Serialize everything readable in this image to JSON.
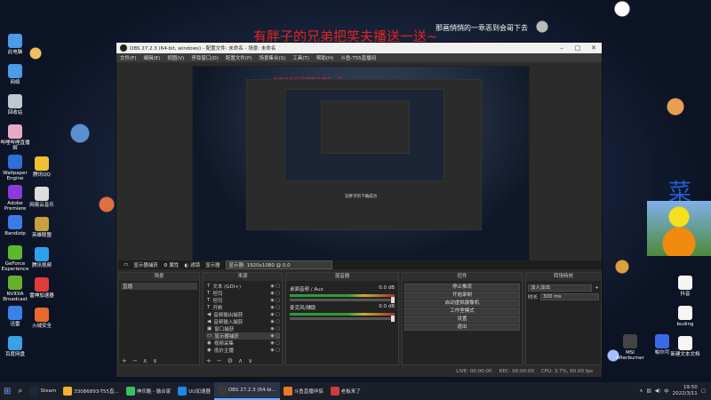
{
  "overlay": {
    "headline": "有胖子的兄弟把笑夫播送一送~",
    "top_right_line": "那画悄悄的一乖恶到会哥下去",
    "big_char": "菜",
    "nested_headline": "有胖子的兄弟把笑夫播送一送~",
    "nested_caption": "兄胖子的下确成功"
  },
  "desktop": {
    "left_icons": [
      {
        "label": "此电脑",
        "color": "#4a9be8"
      },
      {
        "label": "网络",
        "color": "#4a9be8"
      },
      {
        "label": "回收站",
        "color": "#bfc7d2"
      },
      {
        "label": "哔哩哔哩直播姬",
        "color": "#e8a9c4"
      },
      {
        "label": "Wallpaper Engine",
        "color": "#2f6fd6"
      },
      {
        "label": "Adobe Premiere",
        "color": "#8a3ad6"
      },
      {
        "label": "Bandizip",
        "color": "#3a7be8"
      },
      {
        "label": "GeForce Experience",
        "color": "#5cb82c"
      },
      {
        "label": "NVIDIA Broadcast",
        "color": "#6aae2e"
      },
      {
        "label": "迅雷",
        "color": "#3a82e8"
      },
      {
        "label": "百度网盘",
        "color": "#3aa0e8"
      }
    ],
    "second_column_icons": [
      {
        "label": "腾讯QQ",
        "color": "#f0c030"
      },
      {
        "label": "网易云音乐",
        "color": "#ddd"
      },
      {
        "label": "英雄联盟",
        "color": "#c8a040"
      },
      {
        "label": "腾讯视频",
        "color": "#2fa0f0"
      },
      {
        "label": "雷神加速器",
        "color": "#e03a3a"
      },
      {
        "label": "火绒安全",
        "color": "#e86a2a"
      }
    ],
    "right_icons": [
      {
        "label": "抖音",
        "color": "#f5f5f5"
      },
      {
        "label": "buding",
        "color": "#f5f5f5"
      },
      {
        "label": "新建文本文档",
        "color": "#f5f5f5"
      },
      {
        "label": "MSI Afterburner",
        "color": "#444"
      },
      {
        "label": "帕尔可",
        "color": "#3a6ae8"
      }
    ]
  },
  "obs": {
    "title": "OBS 27.2.3 (64-bit, windows) - 配置文件: 未命名 - 场景: 未命名",
    "menu": [
      "文件(F)",
      "编辑(E)",
      "视图(V)",
      "停靠窗口(D)",
      "配置文件(P)",
      "场景集合(S)",
      "工具(T)",
      "帮助(H)",
      "斗鱼-T55直播间"
    ],
    "source_bar": {
      "name": "显示器捕获",
      "properties": "属性",
      "filters": "滤镜",
      "display_label": "显示器",
      "display_value": "显示器: 1920x1080 @ 0,0"
    },
    "docks": {
      "scenes": {
        "title": "场景",
        "items": [
          "直播"
        ]
      },
      "sources": {
        "title": "来源",
        "items": [
          {
            "label": "文本 (GDI+)",
            "icon": "T",
            "selected": false
          },
          {
            "label": "坦司",
            "icon": "T",
            "selected": false
          },
          {
            "label": "坦司",
            "icon": "T",
            "selected": false
          },
          {
            "label": "开刷",
            "icon": "T",
            "selected": false
          },
          {
            "label": "音频输出捕获",
            "icon": "◀",
            "selected": false
          },
          {
            "label": "音频输入捕获",
            "icon": "◀",
            "selected": false
          },
          {
            "label": "窗口捕获",
            "icon": "▣",
            "selected": false
          },
          {
            "label": "显示器捕获",
            "icon": "▭",
            "selected": true
          },
          {
            "label": "视频采集",
            "icon": "◉",
            "selected": false
          },
          {
            "label": "低价主播",
            "icon": "◉",
            "selected": false
          }
        ]
      },
      "mixer": {
        "title": "混音器",
        "channels": [
          {
            "name": "桌面音频 / Aux",
            "db": "0.0 dB"
          },
          {
            "name": "麦克风/辅助",
            "db": "0.0 dB"
          }
        ]
      },
      "transitions": {
        "title": "转场特效",
        "mode": "淡入淡出",
        "duration_label": "时长",
        "duration_value": "300 ms"
      },
      "controls": {
        "title": "控件",
        "buttons": [
          "停止推流",
          "开始录制",
          "启动虚拟摄像机",
          "工作室模式",
          "设置",
          "退出"
        ]
      }
    },
    "status": {
      "live": "LIVE: 00:00:00",
      "rec": "REC: 00:00:00",
      "cpu": "CPU: 3.7%, 60.00 fps"
    }
  },
  "taskbar": {
    "items": [
      {
        "label": "Steam",
        "color": "#1b2838",
        "active": false
      },
      {
        "label": "33086893-T55直...",
        "color": "#f0b030",
        "active": false
      },
      {
        "label": "神乐酷 - 融合家",
        "color": "#3ac060",
        "active": false
      },
      {
        "label": "UU加速器",
        "color": "#1a8ae8",
        "active": false
      },
      {
        "label": "OBS 27.2.3 (64-bi...",
        "color": "#3a3a3a",
        "active": true
      },
      {
        "label": "斗鱼直播伴侣",
        "color": "#e87a2a",
        "active": false
      },
      {
        "label": "老板来了",
        "color": "#d03a3a",
        "active": false
      }
    ],
    "time": "19:50",
    "date": "2022/3/11",
    "lang": "中"
  }
}
